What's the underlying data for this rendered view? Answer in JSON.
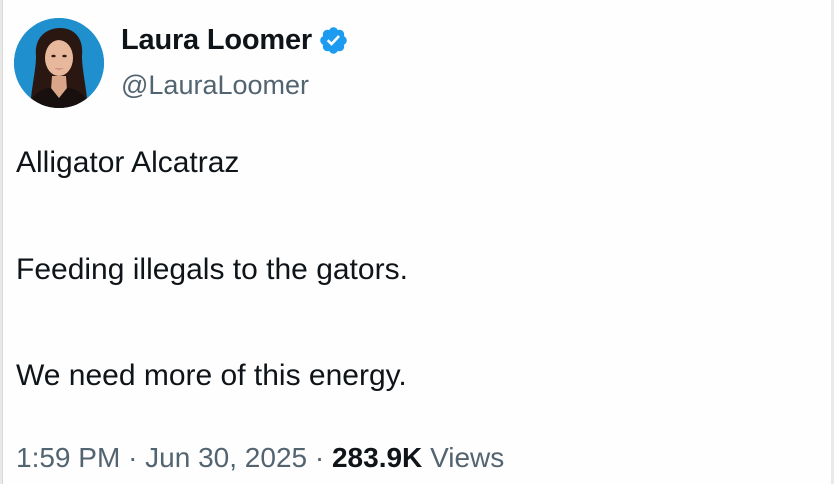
{
  "author": {
    "name": "Laura Loomer",
    "handle": "@LauraLoomer",
    "verified_color": "#1d9bf0"
  },
  "tweet": {
    "lines": [
      "Alligator Alcatraz",
      "Feeding illegals to the gators.",
      "We need more of this energy."
    ]
  },
  "meta": {
    "time": "1:59 PM",
    "separator": "·",
    "date": "Jun 30, 2025",
    "views_count": "283.9K",
    "views_label": "Views"
  },
  "icons": {
    "avatar": "profile-photo",
    "verified": "verified-badge-icon"
  }
}
